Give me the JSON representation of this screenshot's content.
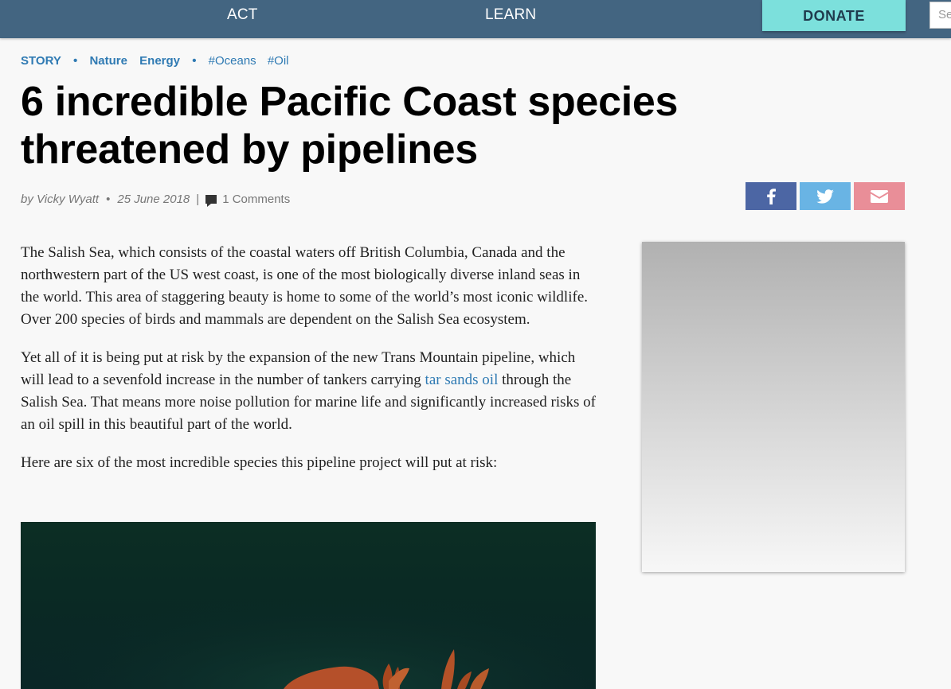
{
  "nav": {
    "act": "ACT",
    "learn": "LEARN",
    "donate": "DONATE",
    "search_placeholder": "Se"
  },
  "tags": {
    "type": "STORY",
    "categories": [
      "Nature",
      "Energy"
    ],
    "hashtags": [
      "#Oceans",
      "#Oil"
    ],
    "separator": "•"
  },
  "article": {
    "title": "6 incredible Pacific Coast species threatened by pipelines",
    "byline": {
      "author": "by Vicky Wyatt",
      "date": "25 June 2018",
      "comments": "1 Comments",
      "dot": "•",
      "pipe": "|"
    },
    "paragraph_1": "The Salish Sea, which consists of the coastal waters off British Columbia, Canada and the northwestern part of the US west coast, is one of the most biologically diverse inland seas in the world. This area of staggering beauty is home to some of the world’s most iconic wildlife. Over 200 species of birds and mammals are dependent on the Salish Sea ecosystem.",
    "paragraph_2_before": "Yet all of it is being put at risk by the expansion of the new Trans Mountain pipeline, which will lead to a sevenfold increase in the number of tankers carrying ",
    "paragraph_2_link": "tar sands oil",
    "paragraph_2_after": " through the Salish Sea. That means more noise pollution for marine life and significantly increased risks of an oil spill in this beautiful part of the world.",
    "paragraph_3": "Here are six of the most incredible species this pipeline project will put at risk:"
  },
  "share": {
    "facebook_icon": "facebook-icon",
    "twitter_icon": "twitter-icon",
    "email_icon": "envelope-icon"
  },
  "colors": {
    "nav_bg": "#436581",
    "donate_bg": "#7ce0dc",
    "link": "#2f7ab3",
    "facebook": "#4c66a4",
    "twitter": "#69b4e4",
    "email": "#e98e98"
  }
}
